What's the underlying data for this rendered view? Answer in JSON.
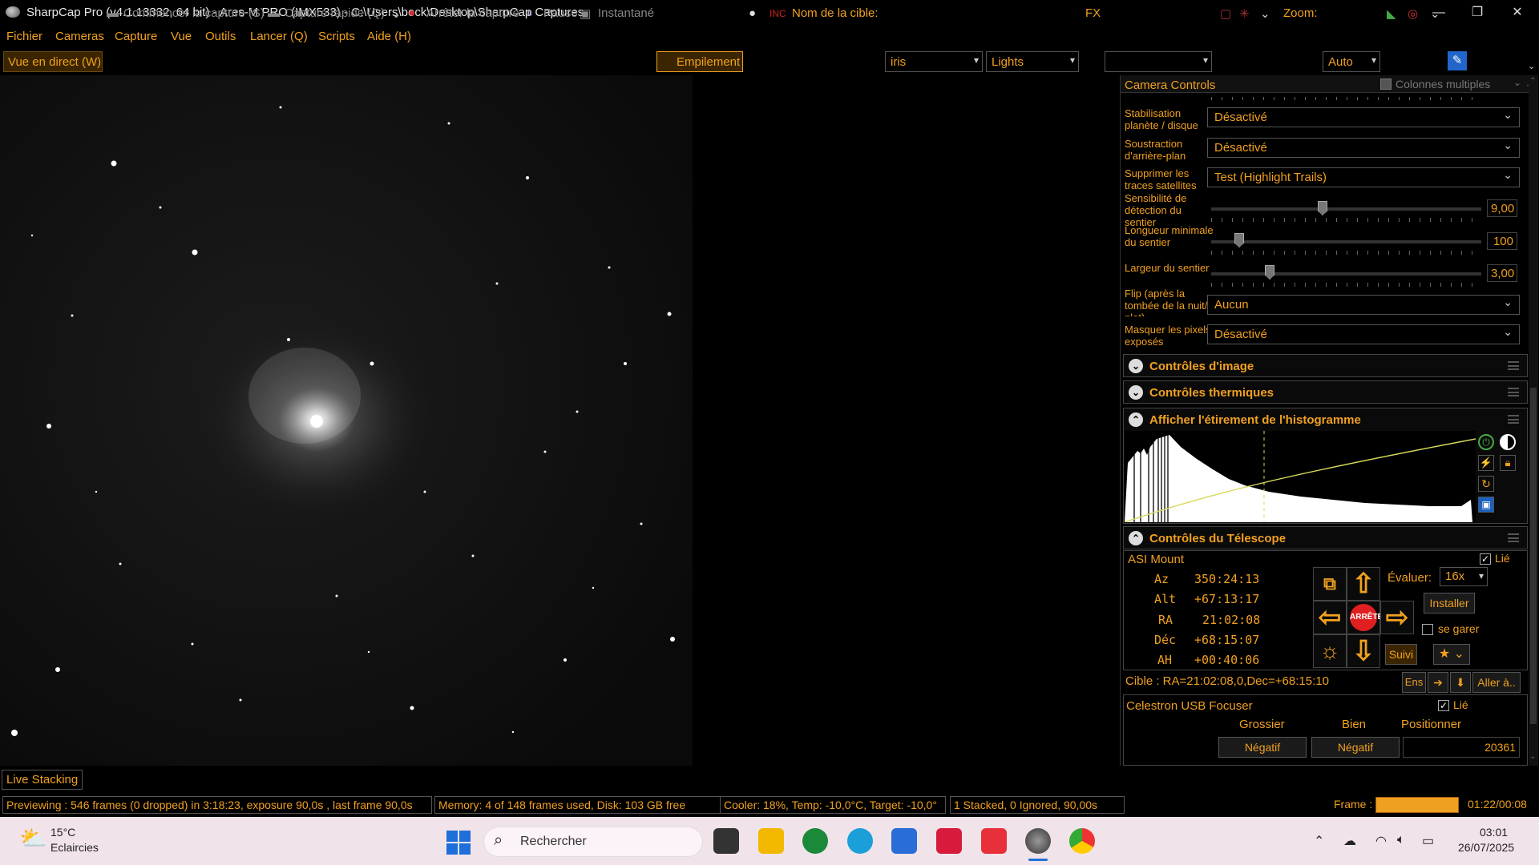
{
  "window": {
    "title": "SharpCap Pro (v4.1.13332, 64 bit) - Ares-M PRO (IMX533) - C:\\Users\\beck\\Desktop\\SharpCap Captures",
    "minimize": "—",
    "maximize": "❐",
    "close": "✕"
  },
  "menu": [
    "Fichier",
    "Cameras",
    "Capture",
    "Vue",
    "Outils",
    "Lancer (Q)",
    "Scripts",
    "Aide (H)"
  ],
  "toolbar": {
    "live_view": "Vue en direct (W)",
    "start_capture": "Commencer la capture (S)",
    "quick_capture": "Capture rapide (Q)",
    "stop_capture": "Arrêter la capture",
    "pause": "Pause",
    "snapshot": "Instantané",
    "stacking": "Empilement",
    "target_label": "Nom de la cible:",
    "target_value": "iris",
    "frame_type": "Lights",
    "fx_label": "FX",
    "zoom_label": "Zoom:",
    "zoom_value": "Auto"
  },
  "panel": {
    "title": "Camera Controls",
    "multi_columns": "Colonnes multiples",
    "rows": [
      {
        "label": "Stabilisation planète / disque",
        "value": "Désactivé"
      },
      {
        "label": "Soustraction d'arrière-plan",
        "value": "Désactivé"
      },
      {
        "label": "Supprimer les traces satellites",
        "value": "Test (Highlight Trails)"
      }
    ],
    "sliders": [
      {
        "label": "Sensibilité de détection du sentier",
        "value": "9,00"
      },
      {
        "label": "Longueur minimale du sentier",
        "value": "100"
      },
      {
        "label": "Largeur du sentier",
        "value": "3,00"
      }
    ],
    "rows2": [
      {
        "label": "Flip (après la tombée de la nuit/à plat)",
        "value": "Aucun"
      },
      {
        "label": "Masquer les pixels exposés",
        "value": "Désactivé"
      }
    ],
    "sections": {
      "image": "Contrôles d'image",
      "thermal": "Contrôles thermiques",
      "histogram": "Afficher l'étirement de l'histogramme",
      "telescope": "Contrôles du Télescope"
    }
  },
  "telescope": {
    "mount": "ASI Mount",
    "linked": "Lié",
    "coords": [
      {
        "k": "Az",
        "v": "350:24:13"
      },
      {
        "k": "Alt",
        "v": "+67:13:17"
      },
      {
        "k": "RA",
        "v": "21:02:08"
      },
      {
        "k": "Déc",
        "v": "+68:15:07"
      },
      {
        "k": "AH",
        "v": "+00:40:06"
      }
    ],
    "stop": "ARRÊTE",
    "rate_label": "Évaluer:",
    "rate_value": "16x",
    "install": "Installer",
    "park": "se garer",
    "tracking": "Suivi",
    "target": "Cible : RA=21:02:08,0,Dec=+68:15:10",
    "set": "Ens",
    "goto": "Aller à.."
  },
  "focuser": {
    "name": "Celestron USB Focuser",
    "linked": "Lié",
    "col1": "Grossier",
    "col2": "Bien",
    "col3": "Positionner",
    "neg1": "Négatif",
    "neg2": "Négatif",
    "position": "20361"
  },
  "live_stacking_tab": "Live Stacking",
  "status": {
    "preview": "Previewing : 546 frames (0 dropped) in 3:18:23, exposure 90,0s , last frame 90,0s",
    "memory": "Memory: 4 of 148 frames used, Disk: 103 GB free",
    "cooler": "Cooler: 18%, Temp: -10,0°C, Target: -10,0°",
    "stacked": "1 Stacked, 0 Ignored, 90,00s",
    "frame_label": "Frame :",
    "frame_time": "01:22/00:08"
  },
  "taskbar": {
    "temp": "15°C",
    "weather": "Eclaircies",
    "search": "Rechercher",
    "time": "03:01",
    "date": "26/07/2025"
  },
  "colors": {
    "accent": "#f0a020",
    "background": "#000000",
    "stop_red": "#e02020"
  }
}
